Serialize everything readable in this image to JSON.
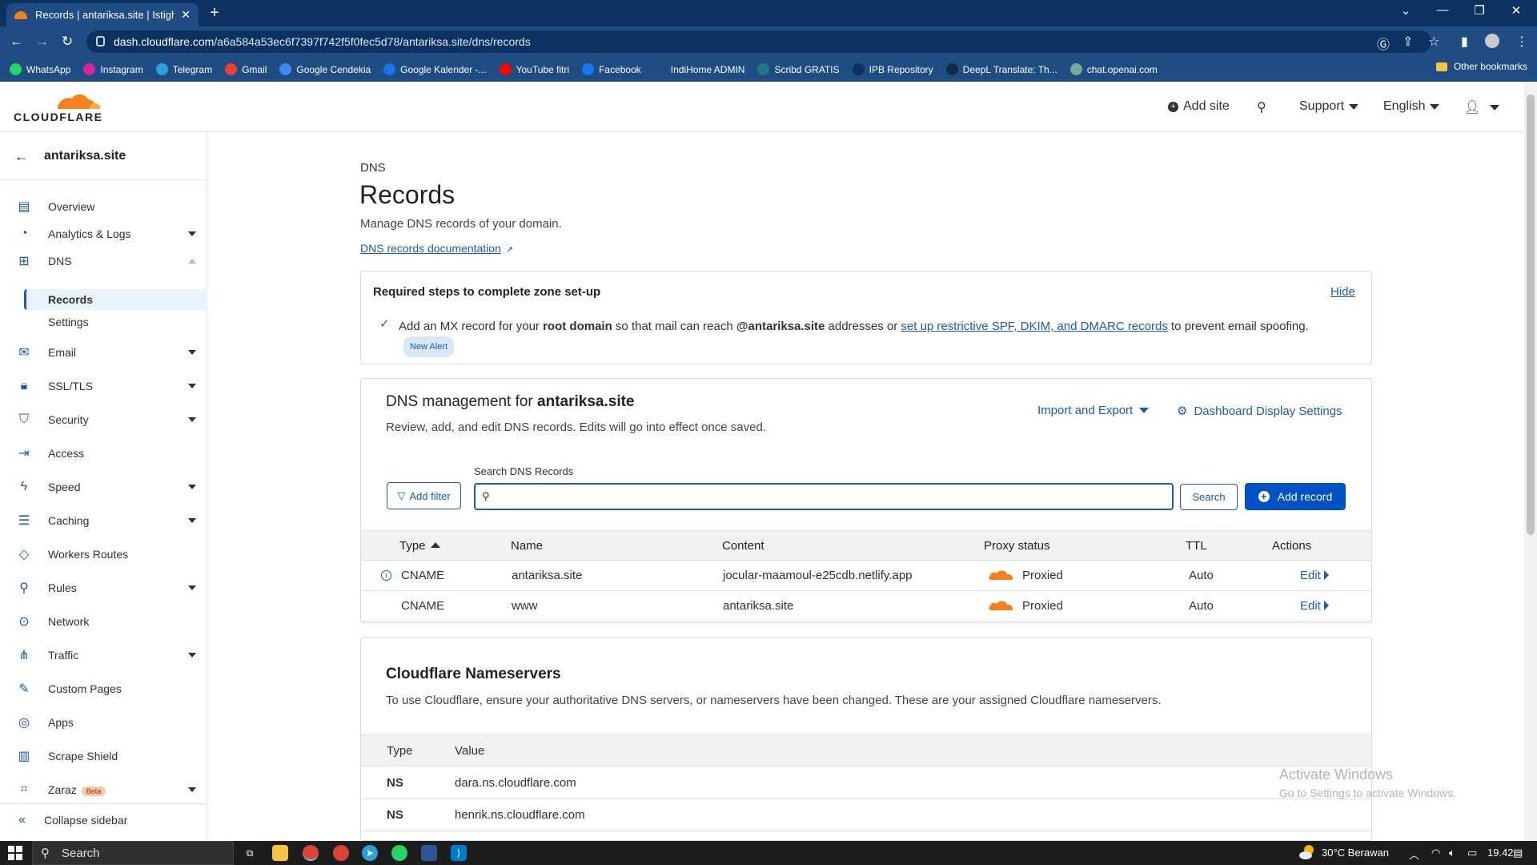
{
  "browser": {
    "tab_title": "Records | antariksa.site | Istighfar",
    "url_domain": "dash.cloudflare.com",
    "url_path": "/a6a584a53ec6f7397f742f5f0fec5d78/antariksa.site/dns/records",
    "bookmarks": [
      {
        "label": "WhatsApp",
        "color": "#25d366"
      },
      {
        "label": "Instagram",
        "color": "#d6249f"
      },
      {
        "label": "Telegram",
        "color": "#2aa1da"
      },
      {
        "label": "Gmail",
        "color": "#ea4335"
      },
      {
        "label": "Google Cendekia",
        "color": "#4285f4"
      },
      {
        "label": "Google Kalender -...",
        "color": "#1a73e8"
      },
      {
        "label": "YouTube fitri",
        "color": "#ff0000"
      },
      {
        "label": "Facebook",
        "color": "#1877f2"
      },
      {
        "label": "IndiHome ADMIN",
        "color": "#1f4c82"
      },
      {
        "label": "Scribd GRATIS",
        "color": "#1e7b85"
      },
      {
        "label": "IPB Repository",
        "color": "#0c3262"
      },
      {
        "label": "DeepL Translate: Th...",
        "color": "#0f2b46"
      },
      {
        "label": "chat.openai.com",
        "color": "#74aa9c"
      }
    ],
    "other_bookmarks": "Other bookmarks"
  },
  "header": {
    "logo_text": "CLOUDFLARE",
    "add_site": "Add site",
    "support": "Support",
    "language": "English"
  },
  "sidebar": {
    "site": "antariksa.site",
    "items": [
      {
        "label": "Overview",
        "icon": "document-icon",
        "glyph": "▤",
        "dropdown": false
      },
      {
        "label": "Analytics & Logs",
        "icon": "chart-icon",
        "glyph": "◔",
        "dropdown": true
      },
      {
        "label": "DNS",
        "icon": "network-icon",
        "glyph": "⊞",
        "dropdown": "open"
      },
      {
        "label": "Email",
        "icon": "email-icon",
        "glyph": "✉",
        "dropdown": true
      },
      {
        "label": "SSL/TLS",
        "icon": "lock-icon",
        "glyph": "🔒︎",
        "dropdown": true
      },
      {
        "label": "Security",
        "icon": "shield-icon",
        "glyph": "⛉",
        "dropdown": true
      },
      {
        "label": "Access",
        "icon": "access-icon",
        "glyph": "⇥",
        "dropdown": false
      },
      {
        "label": "Speed",
        "icon": "bolt-icon",
        "glyph": "ϟ",
        "dropdown": true
      },
      {
        "label": "Caching",
        "icon": "storage-icon",
        "glyph": "☰",
        "dropdown": true
      },
      {
        "label": "Workers Routes",
        "icon": "workers-icon",
        "glyph": "◇",
        "dropdown": false
      },
      {
        "label": "Rules",
        "icon": "rules-icon",
        "glyph": "⚲",
        "dropdown": true
      },
      {
        "label": "Network",
        "icon": "location-icon",
        "glyph": "⊙",
        "dropdown": false
      },
      {
        "label": "Traffic",
        "icon": "traffic-icon",
        "glyph": "⋔",
        "dropdown": true
      },
      {
        "label": "Custom Pages",
        "icon": "wrench-icon",
        "glyph": "✎",
        "dropdown": false
      },
      {
        "label": "Apps",
        "icon": "apps-icon",
        "glyph": "◎",
        "dropdown": false
      },
      {
        "label": "Scrape Shield",
        "icon": "scrape-icon",
        "glyph": "▥",
        "dropdown": false
      },
      {
        "label": "Zaraz",
        "icon": "zaraz-icon",
        "glyph": "⌗",
        "dropdown": true,
        "badge": "Beta"
      }
    ],
    "dns_sub": [
      "Records",
      "Settings"
    ],
    "collapse": "Collapse sidebar"
  },
  "main": {
    "breadcrumb": "DNS",
    "title": "Records",
    "subtitle": "Manage DNS records of your domain.",
    "doc_link": "DNS records documentation",
    "steps": {
      "title": "Required steps to complete zone set-up",
      "hide": "Hide",
      "t1": "Add an MX record for your ",
      "b1": "root domain",
      "t2": " so that mail can reach ",
      "b2": "@antariksa.site",
      "t3": " addresses or ",
      "link": "set up restrictive SPF, DKIM, and DMARC records",
      "t4": " to prevent email spoofing.",
      "badge": "New Alert"
    },
    "dns": {
      "title_prefix": "DNS management for ",
      "title_domain": "antariksa.site",
      "subtitle": "Review, add, and edit DNS records. Edits will go into effect once saved.",
      "import_export": "Import and Export",
      "display_settings": "Dashboard Display Settings",
      "search_label": "Search DNS Records",
      "search_value": "",
      "add_filter": "Add filter",
      "search_button": "Search",
      "add_record": "Add record",
      "columns": [
        "Type",
        "Name",
        "Content",
        "Proxy status",
        "TTL",
        "Actions"
      ],
      "rows": [
        {
          "type": "CNAME",
          "name": "antariksa.site",
          "content": "jocular-maamoul-e25cdb.netlify.app",
          "proxy": "Proxied",
          "ttl": "Auto",
          "action": "Edit"
        },
        {
          "type": "CNAME",
          "name": "www",
          "content": "antariksa.site",
          "proxy": "Proxied",
          "ttl": "Auto",
          "action": "Edit"
        }
      ]
    },
    "nameservers": {
      "title": "Cloudflare Nameservers",
      "subtitle": "To use Cloudflare, ensure your authoritative DNS servers, or nameservers have been changed. These are your assigned Cloudflare nameservers.",
      "columns": [
        "Type",
        "Value"
      ],
      "rows": [
        {
          "type": "NS",
          "value": "dara.ns.cloudflare.com"
        },
        {
          "type": "NS",
          "value": "henrik.ns.cloudflare.com"
        }
      ]
    }
  },
  "watermark": {
    "line1": "Activate Windows",
    "line2": "Go to Settings to activate Windows."
  },
  "taskbar": {
    "search": "Search",
    "weather": "30°C  Berawan",
    "time": "19.42"
  },
  "colors": {
    "accent": "#0051c3",
    "link": "#1e5aa8",
    "cloud": "#f48120"
  }
}
